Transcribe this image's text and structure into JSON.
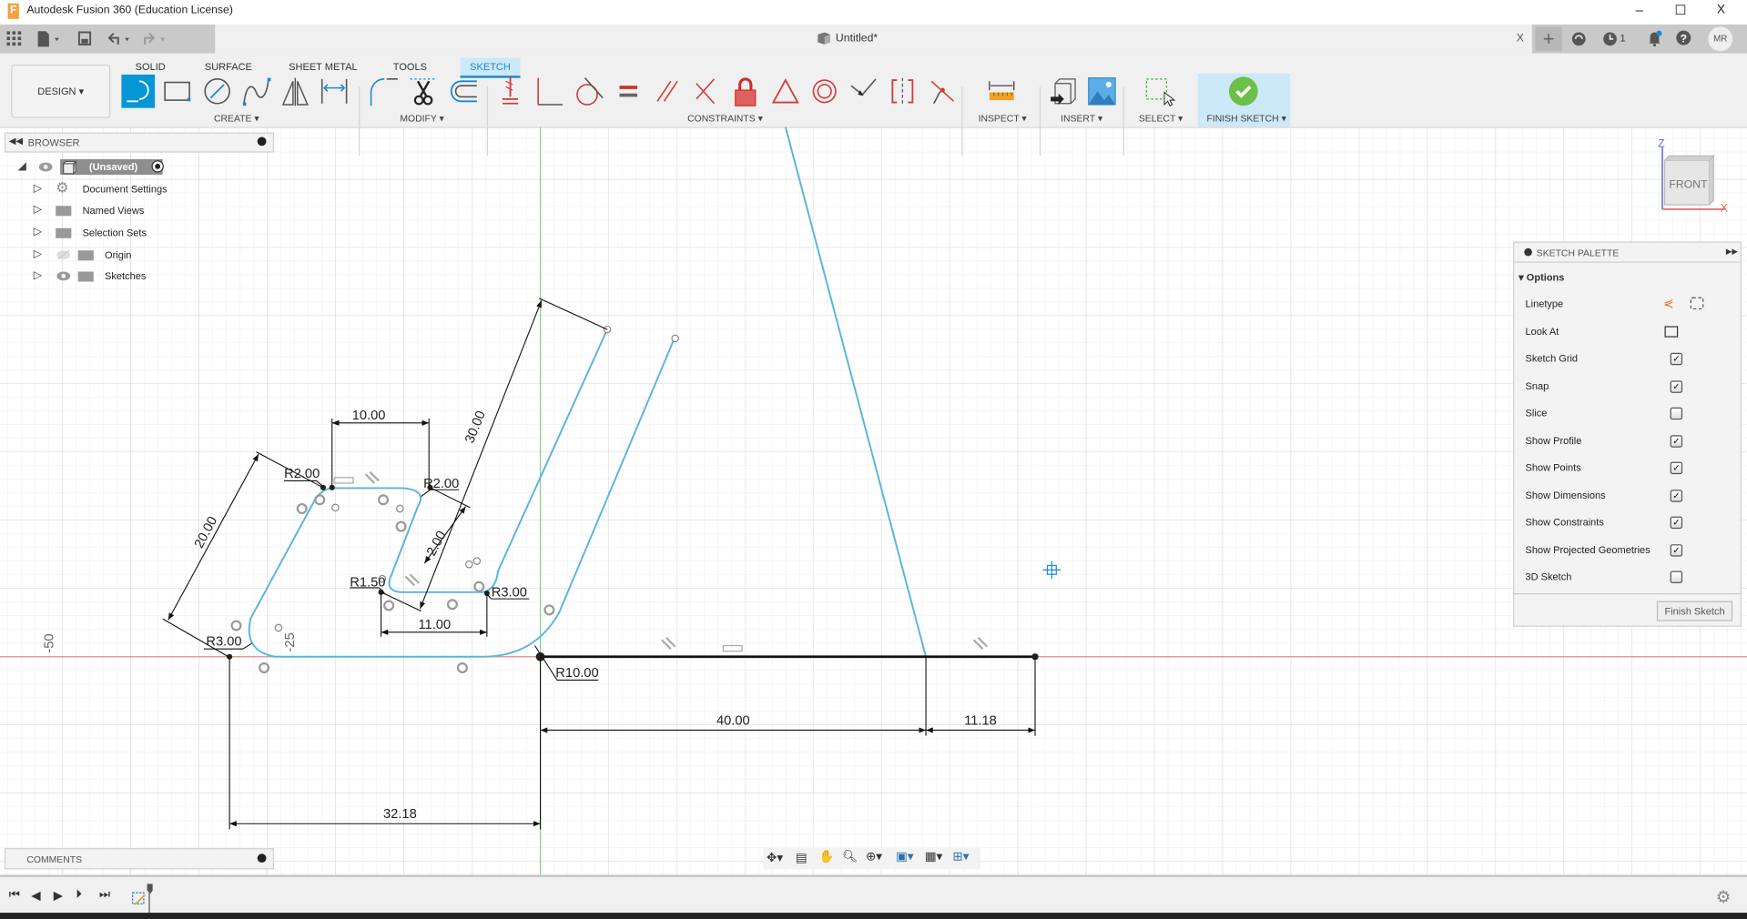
{
  "window": {
    "title": "Autodesk Fusion 360 (Education License)",
    "minimize": "–",
    "maximize": "☐",
    "close": "X"
  },
  "doc_tab": {
    "title": "Untitled*",
    "close": "X",
    "job_count": "1",
    "user_initials": "MR"
  },
  "workspace": {
    "label": "DESIGN"
  },
  "tabs": [
    {
      "label": "SOLID"
    },
    {
      "label": "SURFACE"
    },
    {
      "label": "SHEET METAL"
    },
    {
      "label": "TOOLS"
    },
    {
      "label": "SKETCH",
      "active": true
    }
  ],
  "groups": {
    "create": "CREATE",
    "modify": "MODIFY",
    "constraints": "CONSTRAINTS",
    "inspect": "INSPECT",
    "insert": "INSERT",
    "select": "SELECT",
    "finish": "FINISH SKETCH"
  },
  "browser": {
    "title": "BROWSER",
    "root": "(Unsaved)",
    "items": [
      {
        "label": "Document Settings",
        "icon": "gear-icon"
      },
      {
        "label": "Named Views",
        "icon": "folder-icon"
      },
      {
        "label": "Selection Sets",
        "icon": "folder-icon"
      },
      {
        "label": "Origin",
        "icon": "folder-icon",
        "hidden": true
      },
      {
        "label": "Sketches",
        "icon": "folder-icon"
      }
    ]
  },
  "comments": {
    "title": "COMMENTS"
  },
  "viewcube": {
    "face": "FRONT",
    "axis_z": "Z",
    "axis_x": "X"
  },
  "palette": {
    "title": "SKETCH PALETTE",
    "section": "Options",
    "rows": [
      {
        "label": "Linetype",
        "type": "icons"
      },
      {
        "label": "Look At",
        "type": "icon"
      },
      {
        "label": "Sketch Grid",
        "checked": true
      },
      {
        "label": "Snap",
        "checked": true
      },
      {
        "label": "Slice",
        "checked": false
      },
      {
        "label": "Show Profile",
        "checked": true
      },
      {
        "label": "Show Points",
        "checked": true
      },
      {
        "label": "Show Dimensions",
        "checked": true
      },
      {
        "label": "Show Constraints",
        "checked": true
      },
      {
        "label": "Show Projected Geometries",
        "checked": true
      },
      {
        "label": "3D Sketch",
        "checked": false
      }
    ],
    "finish_button": "Finish Sketch"
  },
  "sketch": {
    "dimensions": [
      "10.00",
      "30.00",
      "20.00",
      "R2.00",
      "R2.00",
      "2.00",
      "R1.50",
      "R3.00",
      "11.00",
      "R3.00",
      "-25",
      "-50",
      "R10.00",
      "40.00",
      "11.18",
      "32.18"
    ]
  },
  "colors": {
    "accent": "#0696d7",
    "sketch_line": "#5ab4e0",
    "x_axis": "#e06666",
    "y_axis": "#6ccf6c",
    "finish": "#6cc04a",
    "constraint": "#d23c3c"
  }
}
